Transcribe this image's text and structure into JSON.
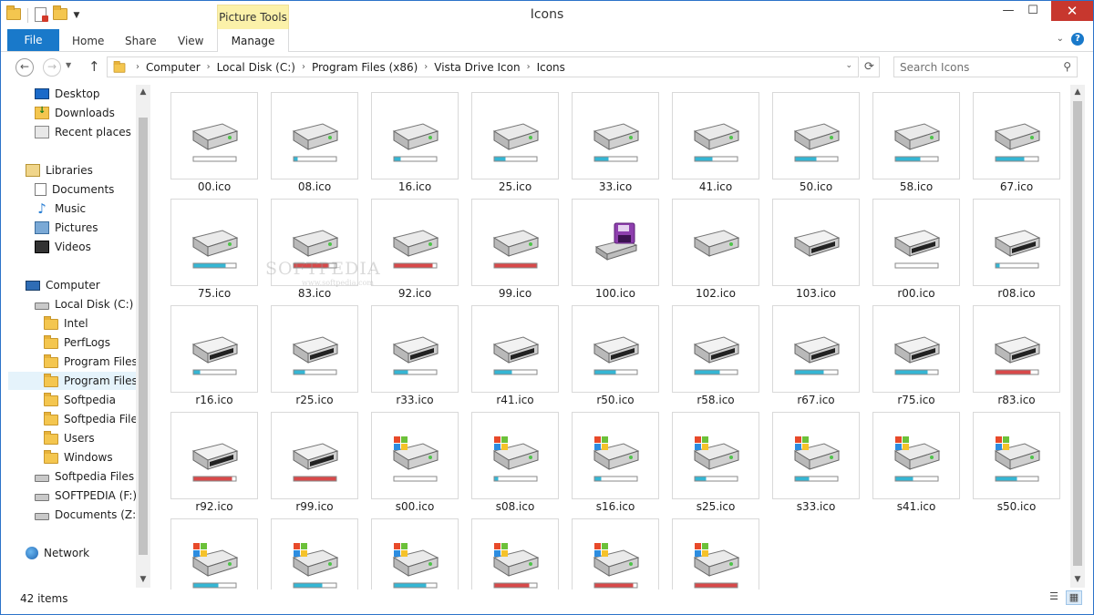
{
  "window": {
    "title": "Icons",
    "context_tab": "Picture Tools"
  },
  "ribbon": {
    "tabs": [
      "File",
      "Home",
      "Share",
      "View",
      "Manage"
    ]
  },
  "address": {
    "crumbs": [
      "Computer",
      "Local Disk (C:)",
      "Program Files (x86)",
      "Vista Drive Icon",
      "Icons"
    ],
    "search_placeholder": "Search Icons"
  },
  "nav": {
    "favorites": [
      "Desktop",
      "Downloads",
      "Recent places"
    ],
    "libraries_header": "Libraries",
    "libraries": [
      "Documents",
      "Music",
      "Pictures",
      "Videos"
    ],
    "computer_header": "Computer",
    "drive_c": "Local Disk (C:)",
    "folders": [
      "Intel",
      "PerfLogs",
      "Program Files",
      "Program Files (",
      "Softpedia",
      "Softpedia Files",
      "Users",
      "Windows"
    ],
    "drives": [
      "Softpedia Files (D",
      "SOFTPEDIA (F:)",
      "Documents (Z:)"
    ],
    "network": "Network",
    "selected": "Program Files ("
  },
  "files": [
    {
      "name": "00.ico",
      "style": "plain",
      "fill": 0.0,
      "color": "#35b6d4"
    },
    {
      "name": "08.ico",
      "style": "plain",
      "fill": 0.08,
      "color": "#35b6d4"
    },
    {
      "name": "16.ico",
      "style": "plain",
      "fill": 0.16,
      "color": "#35b6d4"
    },
    {
      "name": "25.ico",
      "style": "plain",
      "fill": 0.25,
      "color": "#35b6d4"
    },
    {
      "name": "33.ico",
      "style": "plain",
      "fill": 0.33,
      "color": "#35b6d4"
    },
    {
      "name": "41.ico",
      "style": "plain",
      "fill": 0.41,
      "color": "#35b6d4"
    },
    {
      "name": "50.ico",
      "style": "plain",
      "fill": 0.5,
      "color": "#35b6d4"
    },
    {
      "name": "58.ico",
      "style": "plain",
      "fill": 0.58,
      "color": "#35b6d4"
    },
    {
      "name": "67.ico",
      "style": "plain",
      "fill": 0.67,
      "color": "#35b6d4"
    },
    {
      "name": "75.ico",
      "style": "plain",
      "fill": 0.75,
      "color": "#35b6d4"
    },
    {
      "name": "83.ico",
      "style": "plain",
      "fill": 0.83,
      "color": "#d8494a"
    },
    {
      "name": "92.ico",
      "style": "plain",
      "fill": 0.92,
      "color": "#d8494a"
    },
    {
      "name": "99.ico",
      "style": "plain",
      "fill": 1.0,
      "color": "#d8494a"
    },
    {
      "name": "100.ico",
      "style": "floppy",
      "fill": null,
      "color": "#8e3fae"
    },
    {
      "name": "102.ico",
      "style": "plain",
      "fill": null,
      "color": "#35b6d4"
    },
    {
      "name": "103.ico",
      "style": "removable",
      "fill": null,
      "color": "#35b6d4"
    },
    {
      "name": "r00.ico",
      "style": "removable",
      "fill": 0.0,
      "color": "#35b6d4"
    },
    {
      "name": "r08.ico",
      "style": "removable",
      "fill": 0.08,
      "color": "#35b6d4"
    },
    {
      "name": "r16.ico",
      "style": "removable",
      "fill": 0.16,
      "color": "#35b6d4"
    },
    {
      "name": "r25.ico",
      "style": "removable",
      "fill": 0.25,
      "color": "#35b6d4"
    },
    {
      "name": "r33.ico",
      "style": "removable",
      "fill": 0.33,
      "color": "#35b6d4"
    },
    {
      "name": "r41.ico",
      "style": "removable",
      "fill": 0.41,
      "color": "#35b6d4"
    },
    {
      "name": "r50.ico",
      "style": "removable",
      "fill": 0.5,
      "color": "#35b6d4"
    },
    {
      "name": "r58.ico",
      "style": "removable",
      "fill": 0.58,
      "color": "#35b6d4"
    },
    {
      "name": "r67.ico",
      "style": "removable",
      "fill": 0.67,
      "color": "#35b6d4"
    },
    {
      "name": "r75.ico",
      "style": "removable",
      "fill": 0.75,
      "color": "#35b6d4"
    },
    {
      "name": "r83.ico",
      "style": "removable",
      "fill": 0.83,
      "color": "#d8494a"
    },
    {
      "name": "r92.ico",
      "style": "removable",
      "fill": 0.92,
      "color": "#d8494a"
    },
    {
      "name": "r99.ico",
      "style": "removable",
      "fill": 1.0,
      "color": "#d8494a"
    },
    {
      "name": "s00.ico",
      "style": "system",
      "fill": 0.0,
      "color": "#35b6d4"
    },
    {
      "name": "s08.ico",
      "style": "system",
      "fill": 0.08,
      "color": "#35b6d4"
    },
    {
      "name": "s16.ico",
      "style": "system",
      "fill": 0.16,
      "color": "#35b6d4"
    },
    {
      "name": "s25.ico",
      "style": "system",
      "fill": 0.25,
      "color": "#35b6d4"
    },
    {
      "name": "s33.ico",
      "style": "system",
      "fill": 0.33,
      "color": "#35b6d4"
    },
    {
      "name": "s41.ico",
      "style": "system",
      "fill": 0.41,
      "color": "#35b6d4"
    },
    {
      "name": "s50.ico",
      "style": "system",
      "fill": 0.5,
      "color": "#35b6d4"
    },
    {
      "name": "",
      "style": "system",
      "fill": 0.58,
      "color": "#35b6d4"
    },
    {
      "name": "",
      "style": "system",
      "fill": 0.67,
      "color": "#35b6d4"
    },
    {
      "name": "",
      "style": "system",
      "fill": 0.75,
      "color": "#35b6d4"
    },
    {
      "name": "",
      "style": "system",
      "fill": 0.83,
      "color": "#d8494a"
    },
    {
      "name": "",
      "style": "system",
      "fill": 0.92,
      "color": "#d8494a"
    },
    {
      "name": "",
      "style": "system",
      "fill": 1.0,
      "color": "#d8494a"
    }
  ],
  "watermark": {
    "main": "SOFTPEDIA",
    "sub": "www.softpedia.com"
  },
  "status": {
    "count": "42 items"
  },
  "colors": {
    "accent": "#1979ca",
    "close": "#c7372e",
    "context_tab": "#fbf1a9",
    "selection": "#e5f3fb"
  },
  "icons": [
    "folder-icon",
    "properties-icon",
    "back-icon",
    "forward-icon",
    "up-icon",
    "refresh-icon",
    "search-icon",
    "help-icon",
    "details-view-icon",
    "large-icons-view-icon"
  ]
}
